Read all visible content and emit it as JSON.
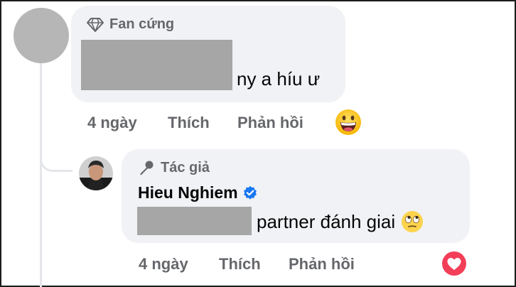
{
  "comment": {
    "badge_label": "Fan cứng",
    "text": "ny a híu ư",
    "time": "4 ngày",
    "like_label": "Thích",
    "reply_label": "Phản hồi",
    "reaction_icon": "grinning-face-emoji"
  },
  "reply": {
    "badge_label": "Tác giả",
    "author_name": "Hieu Nghiem",
    "verified_icon": "verified-badge-icon",
    "text": "partner đánh giai",
    "text_emoji": "rolling-eyes-emoji",
    "time": "4 ngày",
    "like_label": "Thích",
    "reply_label": "Phản hồi",
    "reaction_icon": "love-heart-reaction"
  },
  "colors": {
    "bubble_bg": "#f0f2f5",
    "muted_text": "#65676b",
    "verified_blue": "#1877f2",
    "love_red": "#f33e58"
  }
}
